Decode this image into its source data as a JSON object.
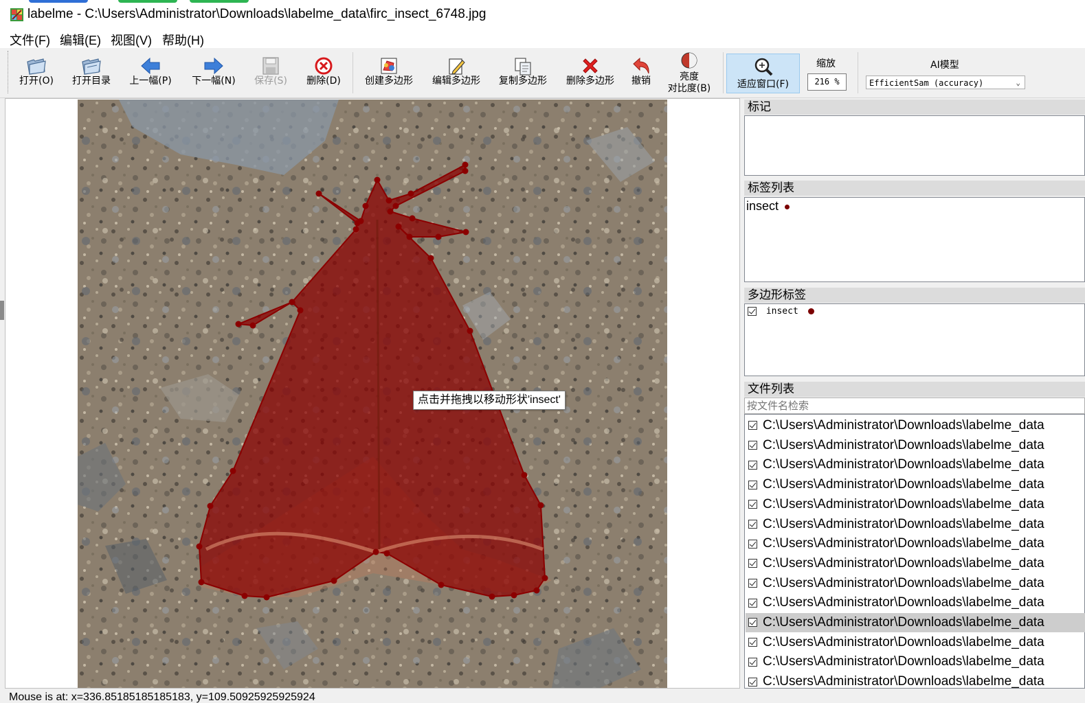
{
  "window": {
    "title": "labelme - C:\\Users\\Administrator\\Downloads\\labelme_data\\firc_insect_6748.jpg",
    "tab_colors": [
      "#2f6fd6",
      "#2db552",
      "#2db552"
    ]
  },
  "menu": {
    "file": "文件(F)",
    "edit": "编辑(E)",
    "view": "视图(V)",
    "help": "帮助(H)"
  },
  "toolbar": {
    "open": "打开(O)",
    "open_dir": "打开目录",
    "prev": "上一幅(P)",
    "next": "下一幅(N)",
    "save": "保存(S)",
    "delete_file": "删除(D)",
    "create_polygon": "创建多边形",
    "edit_polygon": "编辑多边形",
    "copy_polygon": "复制多边形",
    "delete_polygon": "删除多边形",
    "undo": "撤销",
    "brightness_line1": "亮度",
    "brightness_line2": "对比度(B)",
    "fit_window": "适应窗口(F)",
    "zoom_label": "缩放",
    "zoom_value": "216 %",
    "ai_label": "AI模型",
    "ai_model": "EfficientSam (accuracy)"
  },
  "canvas": {
    "tooltip": "点击并拖拽以移动形状'insect'",
    "shape_label": "insect",
    "shape_color": "#8b0000"
  },
  "docks": {
    "flags_title": "标记",
    "label_list_title": "标签列表",
    "label_list_items": [
      {
        "text": "insect",
        "color": "#7b0000"
      }
    ],
    "polygon_labels_title": "多边形标签",
    "polygon_label_items": [
      {
        "text": "insect",
        "checked": true,
        "color": "#7b0000"
      }
    ],
    "file_list_title": "文件列表",
    "file_search_placeholder": "按文件名检索",
    "files": [
      "C:\\Users\\Administrator\\Downloads\\labelme_data",
      "C:\\Users\\Administrator\\Downloads\\labelme_data",
      "C:\\Users\\Administrator\\Downloads\\labelme_data",
      "C:\\Users\\Administrator\\Downloads\\labelme_data",
      "C:\\Users\\Administrator\\Downloads\\labelme_data",
      "C:\\Users\\Administrator\\Downloads\\labelme_data",
      "C:\\Users\\Administrator\\Downloads\\labelme_data",
      "C:\\Users\\Administrator\\Downloads\\labelme_data",
      "C:\\Users\\Administrator\\Downloads\\labelme_data",
      "C:\\Users\\Administrator\\Downloads\\labelme_data",
      "C:\\Users\\Administrator\\Downloads\\labelme_data",
      "C:\\Users\\Administrator\\Downloads\\labelme_data",
      "C:\\Users\\Administrator\\Downloads\\labelme_data",
      "C:\\Users\\Administrator\\Downloads\\labelme_data"
    ],
    "selected_file_index": 10
  },
  "status": {
    "text": "Mouse is at: x=336.85185185185183, y=109.50925925925924"
  }
}
